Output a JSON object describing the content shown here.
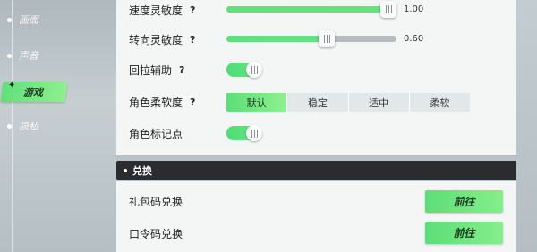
{
  "sidebar": {
    "items": [
      {
        "label": "画面"
      },
      {
        "label": "声音"
      },
      {
        "label": "游戏"
      },
      {
        "label": "隐私"
      }
    ]
  },
  "settings": {
    "speed_sensitivity": {
      "label": "速度灵敏度",
      "help": "?",
      "value_text": "1.00",
      "value": 1.0
    },
    "turn_sensitivity": {
      "label": "转向灵敏度",
      "help": "?",
      "value_text": "0.60",
      "value": 0.6
    },
    "pullback_assist": {
      "label": "回拉辅助",
      "help": "?",
      "on": true
    },
    "character_softness": {
      "label": "角色柔软度",
      "help": "?",
      "options": [
        "默认",
        "稳定",
        "适中",
        "柔软"
      ],
      "selected": "默认"
    },
    "character_marker": {
      "label": "角色标记点",
      "on": true
    }
  },
  "exchange": {
    "title": "兑换",
    "gift_code": {
      "label": "礼包码兑换",
      "button": "前往"
    },
    "password_code": {
      "label": "口令码兑换",
      "button": "前往"
    }
  },
  "colors": {
    "accent_green": "#5fe07a",
    "panel_bg": "#f4f6f6",
    "section_header_bg": "#2a2c2d"
  }
}
